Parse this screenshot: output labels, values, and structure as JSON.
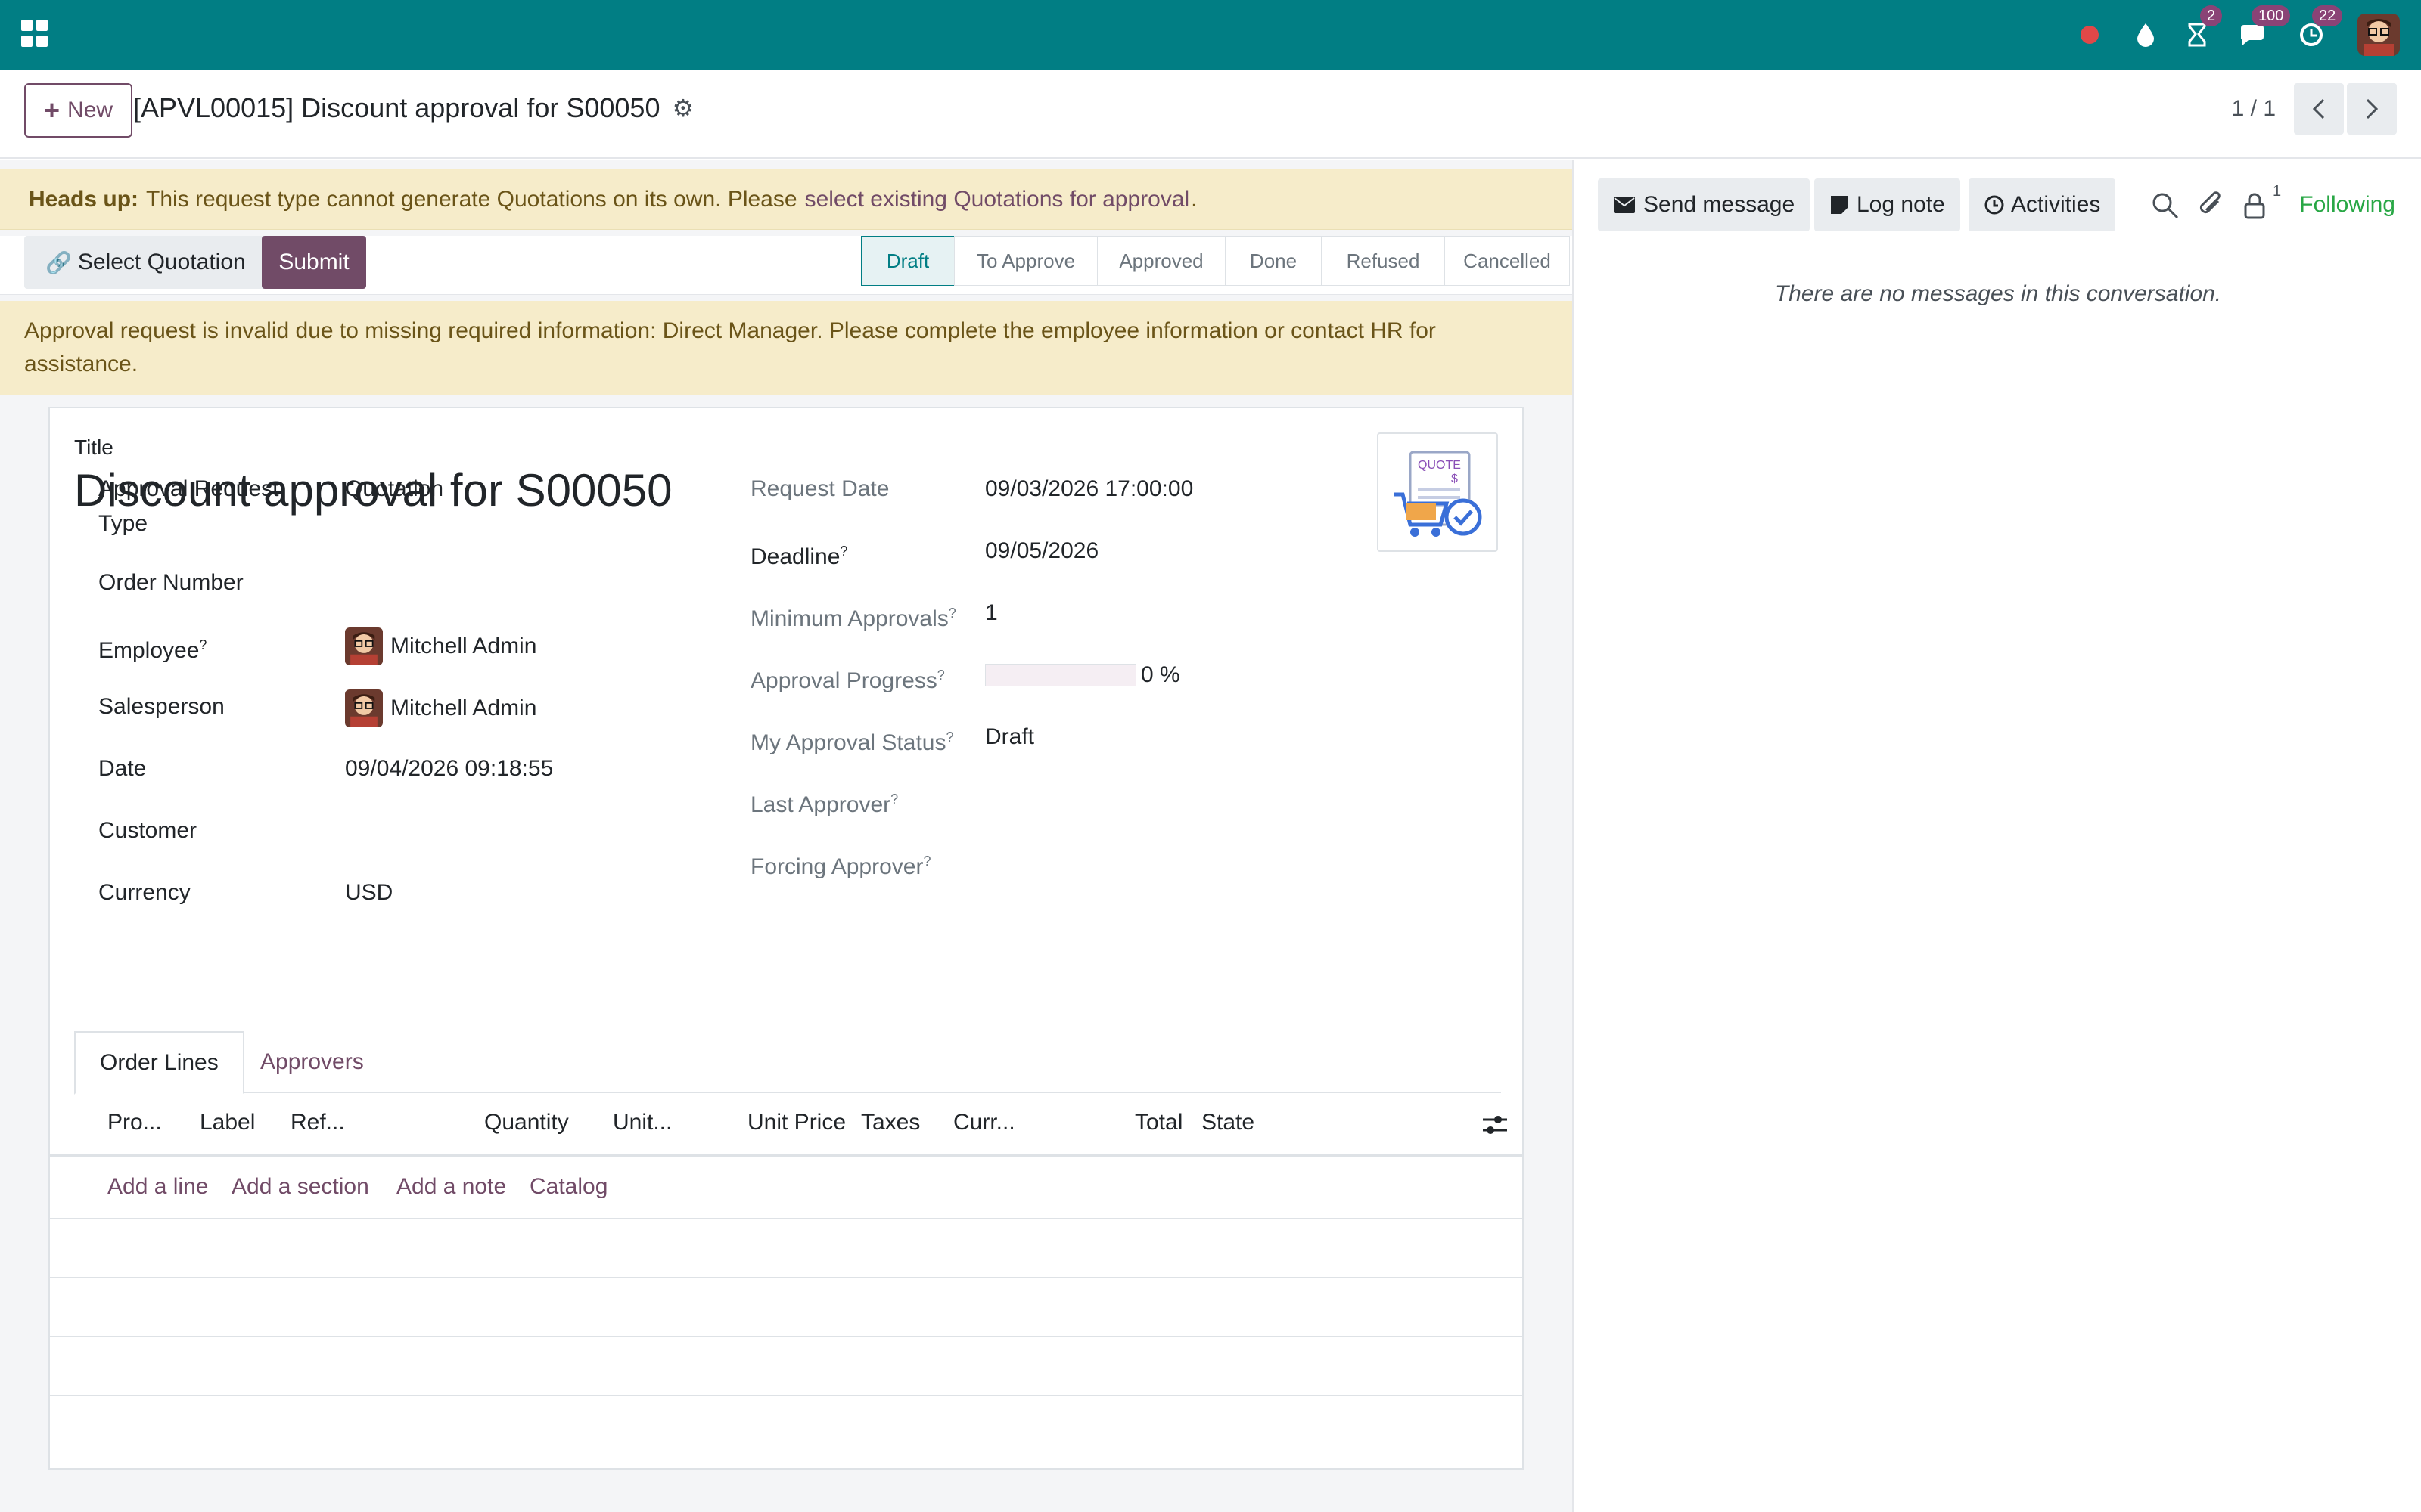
{
  "navbar": {
    "badges": {
      "activities": "2",
      "messages": "100",
      "updates": "22"
    }
  },
  "control": {
    "new_label": "New",
    "breadcrumb": "[APVL00015] Discount approval for S00050",
    "pager": "1 / 1"
  },
  "notice": {
    "heads_up_bold": "Heads up:",
    "heads_up_text": "This request type cannot generate Quotations on its own. Please",
    "heads_up_link": "select existing Quotations for approval",
    "heads_up_end": "."
  },
  "actions": {
    "select_quotation": "Select Quotation",
    "submit": "Submit"
  },
  "stages": [
    "Draft",
    "To Approve",
    "Approved",
    "Done",
    "Refused",
    "Cancelled"
  ],
  "active_stage": "Draft",
  "warning": "Approval request is invalid due to missing required information: Direct Manager. Please complete the employee information or contact HR for assistance.",
  "form": {
    "title_label": "Title",
    "title": "Discount approval for S00050",
    "left": {
      "approval_type_label": "Approval Request Type",
      "approval_type": "Quotation",
      "order_number_label": "Order Number",
      "employee_label": "Employee",
      "employee": "Mitchell Admin",
      "salesperson_label": "Salesperson",
      "salesperson": "Mitchell Admin",
      "date_label": "Date",
      "date": "09/04/2026 09:18:55",
      "customer_label": "Customer",
      "currency_label": "Currency",
      "currency": "USD"
    },
    "right": {
      "request_date_label": "Request Date",
      "request_date": "09/03/2026 17:00:00",
      "deadline_label": "Deadline",
      "deadline": "09/05/2026",
      "min_approvals_label": "Minimum Approvals",
      "min_approvals": "1",
      "progress_label": "Approval Progress",
      "progress": 0,
      "progress_text": "0 %",
      "my_status_label": "My Approval Status",
      "my_status": "Draft",
      "last_approver_label": "Last Approver",
      "forcing_approver_label": "Forcing Approver"
    },
    "tabs": [
      "Order Lines",
      "Approvers"
    ],
    "columns": [
      "Pro...",
      "Label",
      "Ref...",
      "Quantity",
      "Unit...",
      "Unit Price",
      "Taxes",
      "Curr...",
      "Total",
      "State"
    ],
    "add_links": [
      "Add a line",
      "Add a section",
      "Add a note",
      "Catalog"
    ]
  },
  "chatter": {
    "send_message": "Send message",
    "log_note": "Log note",
    "activities": "Activities",
    "followers_count": "1",
    "following": "Following",
    "empty": "There are no messages in this conversation."
  },
  "colors": {
    "navbar": "#017e84",
    "brand": "#714b67",
    "warning_bg": "#f6ecca",
    "following": "#28a745"
  }
}
